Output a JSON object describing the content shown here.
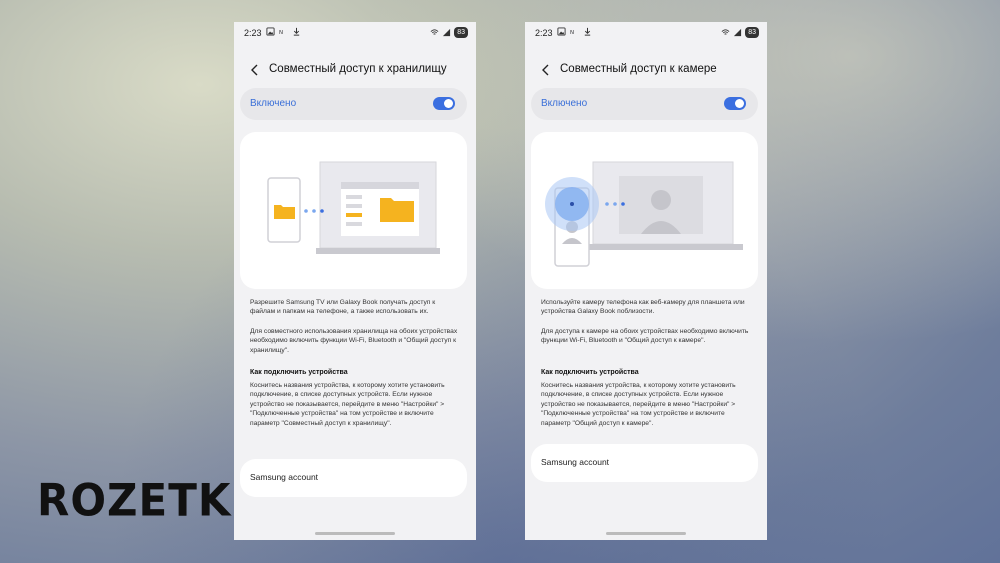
{
  "logo": {
    "text": "ROZETKED"
  },
  "left_screen": {
    "status": {
      "time": "2:23",
      "battery": "83"
    },
    "title": "Совместный доступ к хранилищу",
    "toggle_label": "Включено",
    "paragraph1": "Разрешите Samsung TV или Galaxy Book получать доступ к файлам и папкам на телефоне, а также использовать их.",
    "paragraph2": "Для совместного использования хранилища на обоих устройствах необходимо включить функции Wi-Fi, Bluetooth и \"Общий доступ к хранилищу\".",
    "how_to_heading": "Как подключить устройства",
    "how_to_text": "Коснитесь названия устройства, к которому хотите установить подключение, в списке доступных устройств. Если нужное устройство не показывается, перейдите в меню \"Настройки\" > \"Подключенные устройства\" на том устройстве и включите параметр \"Совместный доступ к хранилищу\".",
    "account_label": "Samsung account"
  },
  "right_screen": {
    "status": {
      "time": "2:23",
      "battery": "83"
    },
    "title": "Совместный доступ к камере",
    "toggle_label": "Включено",
    "paragraph1": "Используйте камеру телефона как веб-камеру для планшета или устройства Galaxy Book поблизости.",
    "paragraph2": "Для доступа к камере на обоих устройствах необходимо включить функции Wi-Fi, Bluetooth и \"Общий доступ к камере\".",
    "how_to_heading": "Как подключить устройства",
    "how_to_text": "Коснитесь названия устройства, к которому хотите установить подключение, в списке доступных устройств. Если нужное устройство не показывается, перейдите в меню \"Настройки\" > \"Подключенные устройства\" на том устройстве и включите параметр \"Общий доступ к камере\".",
    "account_label": "Samsung account"
  },
  "colors": {
    "accent": "#3b6fe0",
    "folder": "#f5b31f",
    "background": "#f2f2f4"
  },
  "icons": [
    "back-arrow-icon",
    "image-icon",
    "download-icon",
    "wifi-icon",
    "signal-icon",
    "battery-icon",
    "folder-icon",
    "person-icon"
  ]
}
